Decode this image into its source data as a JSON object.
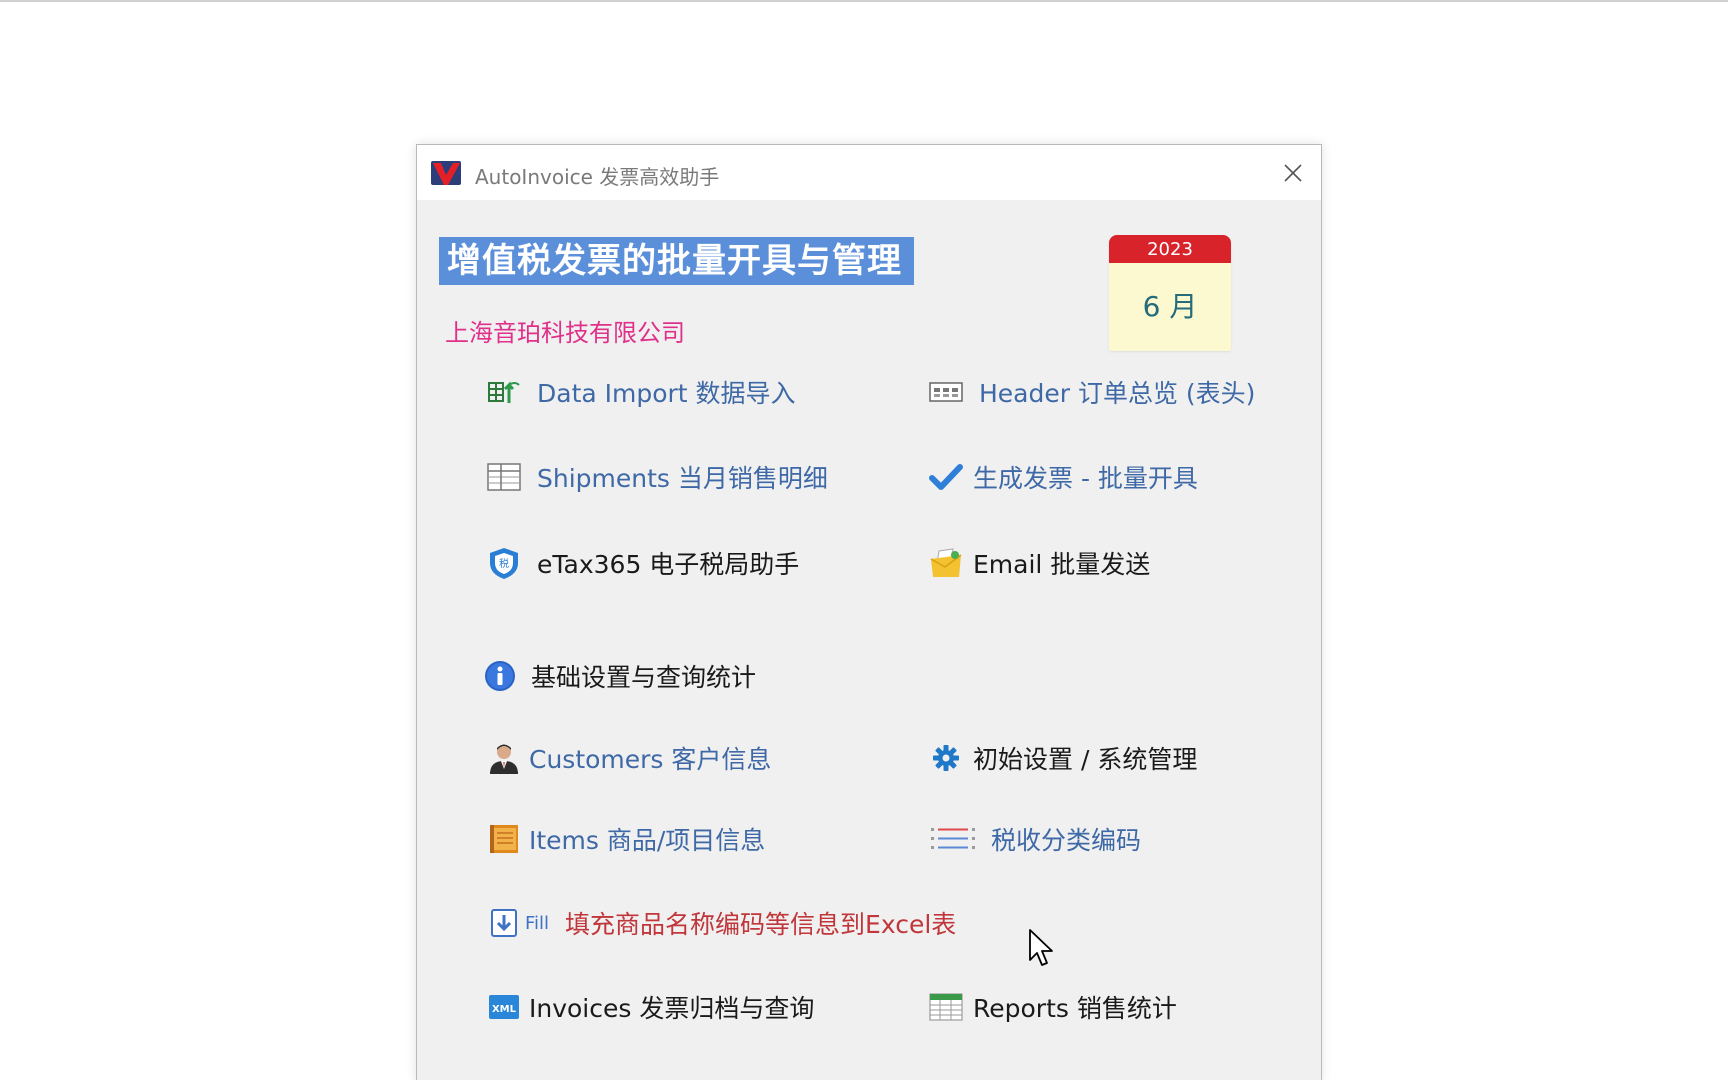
{
  "window": {
    "title": "AutoInvoice 发票高效助手",
    "close_symbol": "✕"
  },
  "header": {
    "main_title": "增值税发票的批量开具与管理",
    "company": "上海音珀科技有限公司"
  },
  "calendar": {
    "year": "2023",
    "month": "6 月"
  },
  "menu": {
    "data_import": "Data Import 数据导入",
    "header_overview": "Header 订单总览 (表头)",
    "shipments": "Shipments 当月销售明细",
    "generate_invoice": "生成发票 - 批量开具",
    "etax": "eTax365 电子税局助手",
    "email": "Email 批量发送",
    "basic_settings": "基础设置与查询统计",
    "customers": "Customers 客户信息",
    "initial_settings": "初始设置 / 系统管理",
    "items": "Items 商品/项目信息",
    "tax_codes": "税收分类编码",
    "fill_badge": "Fill",
    "fill_excel": "填充商品名称编码等信息到Excel表",
    "invoices": "Invoices 发票归档与查询",
    "reports": "Reports 销售统计"
  },
  "icons": {
    "app_logo": "autoinvoice-logo-icon",
    "close": "close-icon",
    "data_import": "table-import-icon",
    "header": "keyboard-grid-icon",
    "shipments": "spreadsheet-grid-icon",
    "generate": "checkmark-icon",
    "etax": "shield-icon",
    "email": "folder-mail-icon",
    "info": "info-icon",
    "customers": "person-avatar-icon",
    "settings": "gear-icon",
    "items": "notebook-icon",
    "tax_codes": "list-icon",
    "fill": "download-arrow-icon",
    "invoices": "xml-file-icon",
    "reports": "table-report-icon"
  },
  "colors": {
    "title_bg": "#5b8fd9",
    "company_text": "#e0308a",
    "link_blue": "#3e69a6",
    "fill_red": "#c0363a",
    "calendar_red": "#d8232a"
  }
}
